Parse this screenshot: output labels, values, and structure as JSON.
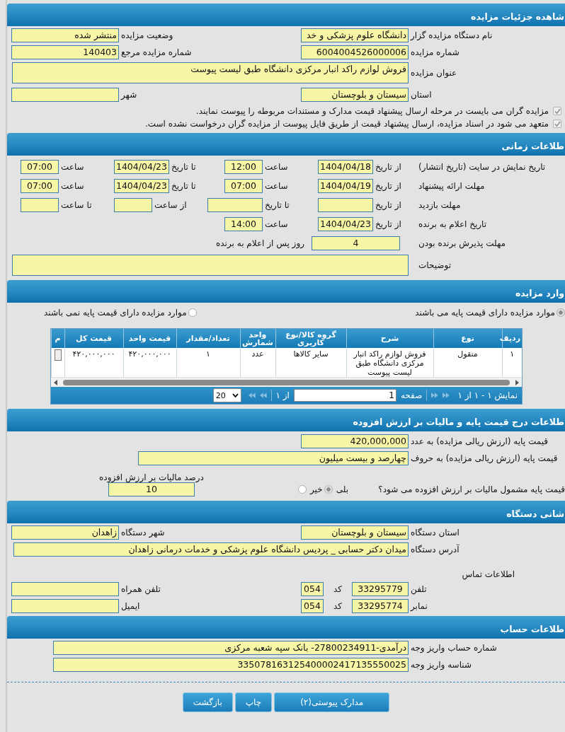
{
  "details": {
    "title": "شاهده جزئیات مزایده",
    "fields": [
      {
        "label": "نام دستگاه مزایده گزار",
        "value": "دانشگاه علوم پزشکی و خد"
      },
      {
        "label": "وضعیت مزایده",
        "value": "منتشر شده"
      },
      {
        "label": "شماره مزایده",
        "value": "6004004526000006"
      },
      {
        "label": "شماره مزایده مرجع",
        "value": "140403"
      },
      {
        "label": "عنوان مزایده",
        "value": "فروش لوازم راکد انبار مرکزی دانشگاه طبق لیست پیوست"
      },
      {
        "label": "استان",
        "value": "سیستان و بلوچستان"
      },
      {
        "label": "شهر"
      }
    ],
    "checks": [
      {
        "text": "مزایده گران می بایست در مرحله ارسال پیشنهاد قیمت مدارک و مستندات مربوطه را پیوست نمایند.",
        "checked": true
      },
      {
        "text": "متعهد می شود در اسناد مزایده، ارسال پیشنهاد قیمت از طریق فایل پیوست از مزایده گران درخواست نشده است.",
        "checked": true
      }
    ]
  },
  "timing": {
    "title": "طلاعات زمانی",
    "rows": [
      {
        "label": "تاریخ نمایش در سایت (تاریخ انتشار)",
        "cells": [
          {
            "kind": "caption",
            "text": "از تاریخ"
          },
          {
            "kind": "date",
            "value": "1404/04/18"
          },
          {
            "kind": "caption",
            "text": "ساعت"
          },
          {
            "kind": "time",
            "value": "12:00"
          },
          {
            "kind": "caption",
            "text": "تا تاریخ"
          },
          {
            "kind": "date",
            "value": "1404/04/23"
          },
          {
            "kind": "caption",
            "text": "ساعت"
          },
          {
            "kind": "time",
            "value": "07:00"
          }
        ]
      },
      {
        "label": "مهلت ارائه پیشنهاد",
        "cells": [
          {
            "kind": "caption",
            "text": "از تاریخ"
          },
          {
            "kind": "date",
            "value": "1404/04/19"
          },
          {
            "kind": "caption",
            "text": "ساعت"
          },
          {
            "kind": "time",
            "value": "07:00"
          },
          {
            "kind": "caption",
            "text": "تا تاریخ"
          },
          {
            "kind": "date",
            "value": "1404/04/23"
          },
          {
            "kind": "caption",
            "text": "ساعت"
          },
          {
            "kind": "time",
            "value": "07:00"
          }
        ]
      },
      {
        "label": "مهلت بازدید",
        "cells": [
          {
            "kind": "caption",
            "text": "از تاریخ"
          },
          {
            "kind": "date"
          },
          {
            "kind": "caption",
            "text": "تا تاریخ"
          },
          {
            "kind": "date"
          },
          {
            "kind": "caption",
            "text": "از ساعت"
          },
          {
            "kind": "time"
          },
          {
            "kind": "caption",
            "text": "تا ساعت"
          },
          {
            "kind": "time"
          }
        ]
      },
      {
        "label": "تاریخ اعلام به برنده",
        "cells": [
          {
            "kind": "caption",
            "text": "از تاریخ"
          },
          {
            "kind": "date",
            "value": "1404/04/23"
          },
          {
            "kind": "caption",
            "text": "ساعت"
          },
          {
            "kind": "time",
            "value": "14:00"
          }
        ]
      },
      {
        "label": "توضیحات",
        "cells": [
          {
            "kind": "memo"
          }
        ]
      }
    ],
    "acceptance": {
      "label": "مهلت پذیرش برنده بودن",
      "value": "4",
      "unit": "روز پس از اعلام به برنده"
    }
  },
  "items": {
    "title": "وارد مزایده",
    "filters": [
      {
        "label": "موارد مزایده دارای قیمت پایه می باشند",
        "selected": true
      },
      {
        "label": "موارد مزایده دارای قیمت پایه نمی باشند",
        "selected": false
      }
    ],
    "table": {
      "columns": [
        "ردیف",
        "نوع",
        "شرح",
        "گروه کالا/نوع کاربری",
        "واحد شمارش",
        "تعداد/مقدار",
        "قیمت واحد",
        "قیمت کل",
        "م"
      ],
      "rows": [
        {
          "cells": [
            "۱",
            "منقول",
            "فروش لوازم راکد انبار مرکزی دانشگاه طبق لیست پیوست",
            "سایر کالاها",
            "عدد",
            "۱",
            "۴۲۰,۰۰۰,۰۰۰",
            "۴۲۰,۰۰۰,۰۰۰"
          ]
        }
      ]
    },
    "pager": {
      "summary": "نمایش ۱ - ۱ از ۱",
      "page_label": "صفحه",
      "page": "1",
      "of": "از ۱",
      "page_size": "20"
    }
  },
  "price": {
    "title": "طلاعات درج قیمت پایه و مالیات بر ارزش افزوده",
    "fields": [
      {
        "label": "قیمت پایه (ارزش ریالی مزایده) به عدد",
        "value": "420,000,000"
      },
      {
        "label": "قیمت پایه (ارزش ریالی مزایده) به حروف",
        "value": "چهارصد و بیست میلیون"
      }
    ],
    "vat_question": {
      "label": "قیمت پایه مشمول مالیات بر ارزش افزوده می شود؟",
      "options": [
        {
          "label": "بلی",
          "selected": true
        },
        {
          "label": "خیر",
          "selected": false
        }
      ]
    },
    "vat_rate": {
      "label": "درصد مالیات بر ارزش افزوده",
      "value": "10"
    }
  },
  "address": {
    "title": "شانی دستگاه",
    "fields": [
      {
        "label": "استان دستگاه",
        "value": "سیستان و بلوچستان"
      },
      {
        "label": "شهر دستگاه",
        "value": "زاهدان"
      },
      {
        "label": "آدرس دستگاه",
        "value": "میدان دکتر حسابی _ پردیس دانشگاه علوم پزشکی و خدمات درمانی زاهدان"
      }
    ],
    "contact_title": "اطلاعات تماس",
    "contacts": [
      {
        "label": "تلفن",
        "value": "33295779",
        "code_label": "کد",
        "code": "054",
        "other_label": "تلفن همراه"
      },
      {
        "label": "نمابر",
        "value": "33295774",
        "code_label": "کد",
        "code": "054",
        "other_label": "ایمیل"
      }
    ]
  },
  "account": {
    "title": "طلاعات حساب",
    "fields": [
      {
        "label": "شماره حساب واریز وجه",
        "value": "درآمدی-27800234911- بانک سپه شعبه مرکزی"
      },
      {
        "label": "شناسه واریز وجه",
        "value": "335078163125400002417135550025"
      }
    ]
  },
  "buttons": [
    "مدارک پیوستی(۲)",
    "چاپ",
    "بازگشت"
  ]
}
